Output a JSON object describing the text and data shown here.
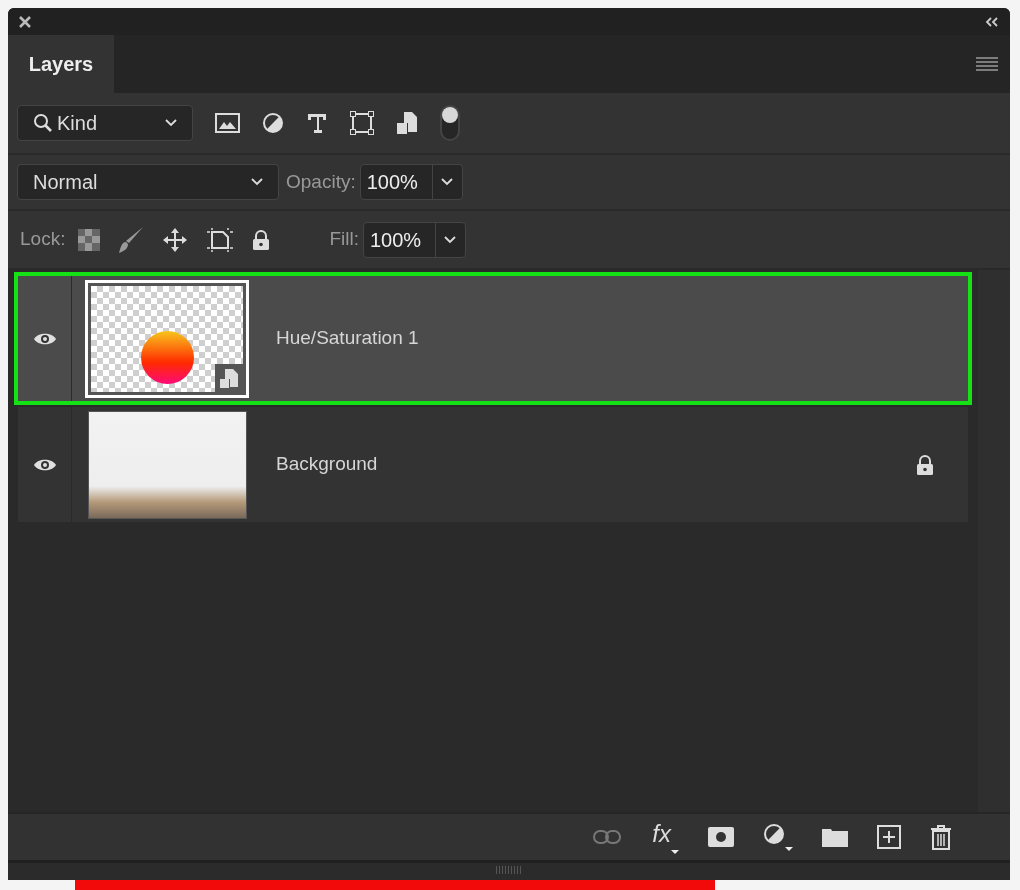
{
  "tabs": [
    {
      "label": "Layers",
      "selected": true
    }
  ],
  "filter": {
    "value": "Kind",
    "enabled": true
  },
  "blend": {
    "value": "Normal",
    "opacity_label": "Opacity:",
    "opacity": "100%"
  },
  "lock": {
    "label": "Lock:",
    "fill_label": "Fill:",
    "fill": "100%"
  },
  "layers": [
    {
      "name": "Hue/Saturation 1",
      "kind": "smart",
      "visible": true,
      "selected": true,
      "locked": false
    },
    {
      "name": "Background",
      "kind": "photo",
      "visible": true,
      "selected": false,
      "locked": true
    }
  ],
  "footer": {
    "effects_label": "fx"
  }
}
